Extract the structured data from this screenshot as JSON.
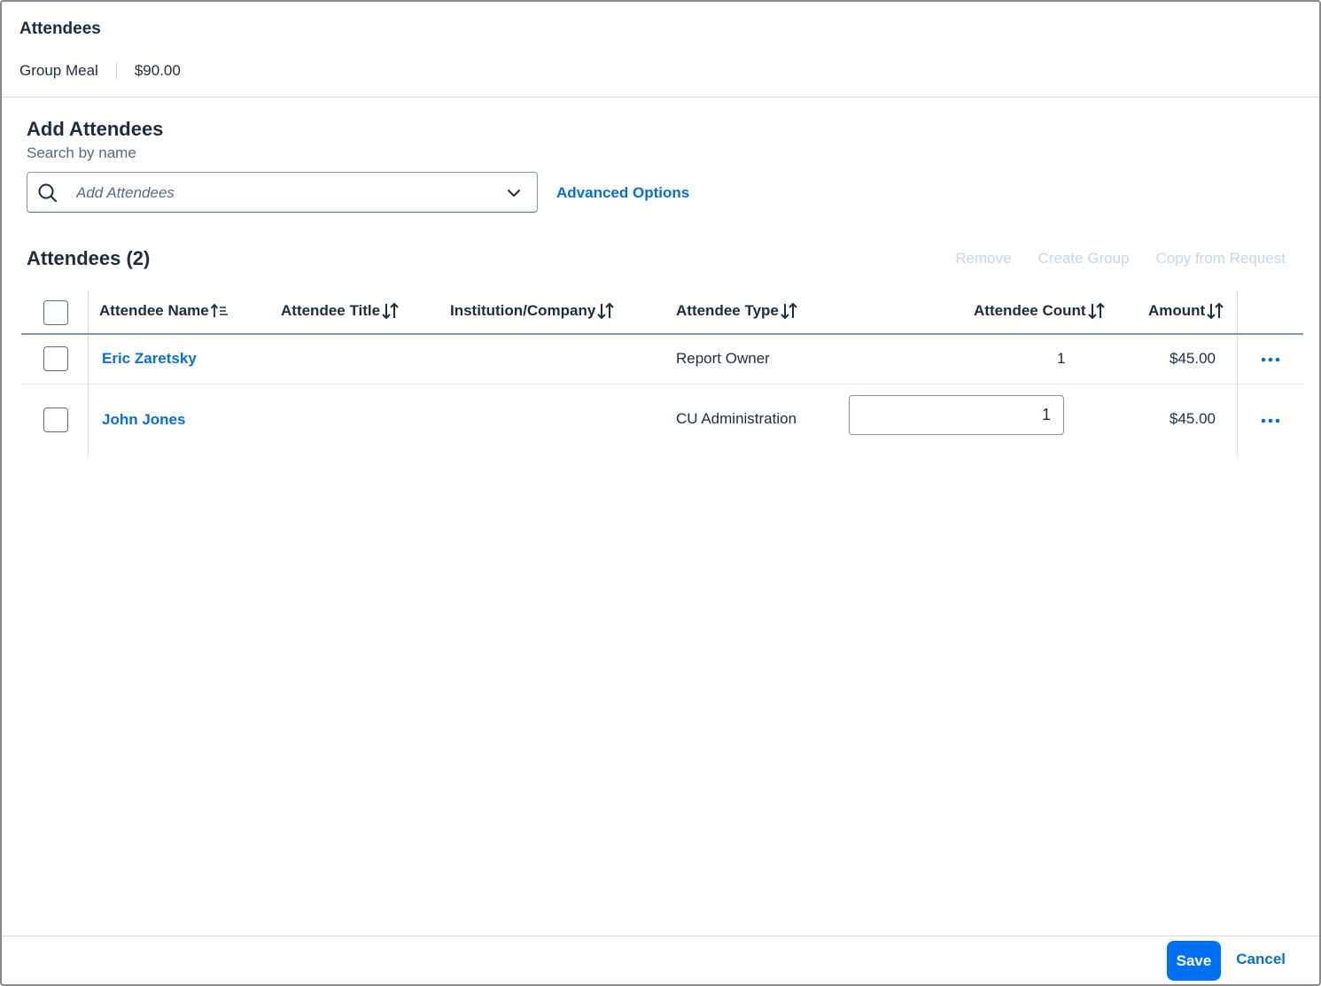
{
  "dialog": {
    "title": "Attendees",
    "expense_type": "Group Meal",
    "expense_amount": "$90.00"
  },
  "add_section": {
    "title": "Add Attendees",
    "search_label": "Search by name",
    "search_placeholder": "Add Attendees",
    "advanced_options": "Advanced Options"
  },
  "list_section": {
    "title": "Attendees (2)",
    "toolbar": {
      "remove": "Remove",
      "create_group": "Create Group",
      "copy_from_request": "Copy from Request"
    },
    "columns": {
      "name": "Attendee Name",
      "title": "Attendee Title",
      "company": "Institution/Company",
      "type": "Attendee Type",
      "count": "Attendee Count",
      "amount": "Amount"
    },
    "rows": [
      {
        "name": "Eric Zaretsky",
        "title": "",
        "company": "",
        "type": "Report Owner",
        "count": "1",
        "amount": "$45.00"
      },
      {
        "name": "John Jones",
        "title": "",
        "company": "",
        "type": "CU Administration",
        "count": "1",
        "amount": "$45.00"
      }
    ]
  },
  "footer": {
    "save": "Save",
    "cancel": "Cancel"
  },
  "colors": {
    "link": "#0a6ed1",
    "primary_button": "#0070f2",
    "disabled_text": "#c5d6e8"
  }
}
